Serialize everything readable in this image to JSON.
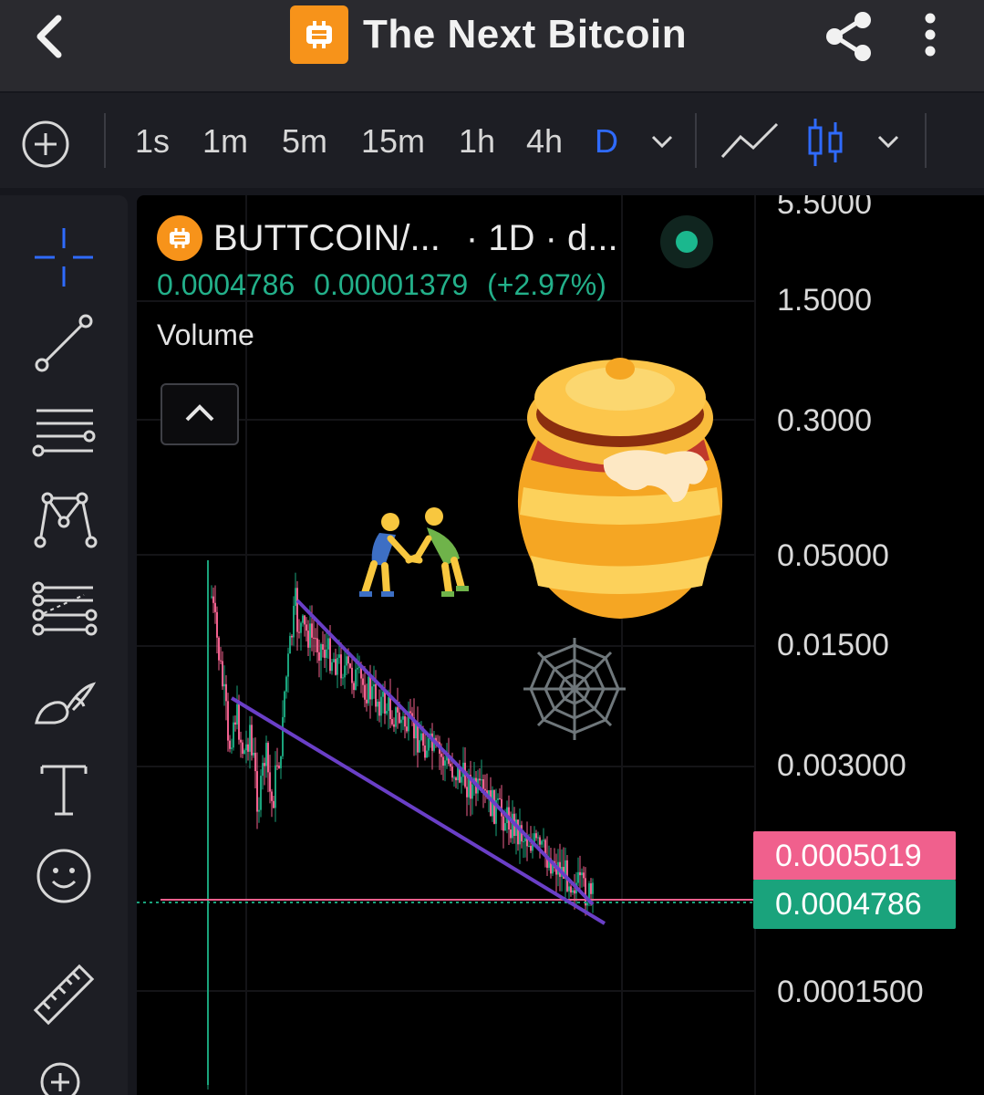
{
  "header": {
    "title": "The Next Bitcoin",
    "logo_glyph": "₿"
  },
  "toolbar": {
    "timeframes": [
      "1s",
      "1m",
      "5m",
      "15m",
      "1h",
      "4h",
      "D"
    ],
    "active_timeframe": "D"
  },
  "legend": {
    "symbol": "BUTTCOIN/...",
    "interval": "· 1D · d...",
    "last_price": "0.0004786",
    "change": "0.00001379",
    "change_pct": "(+2.97%)",
    "volume_label": "Volume"
  },
  "price_axis": [
    "5.5000",
    "1.5000",
    "0.3000",
    "0.05000",
    "0.01500",
    "0.003000",
    "0.0001500"
  ],
  "price_tags": {
    "red": "0.0005019",
    "green": "0.0004786"
  },
  "colors": {
    "up": "#1aa37c",
    "down": "#f0608d",
    "trendline": "#6a3fc7",
    "accent": "#2f6bff",
    "brand": "#f7931a"
  },
  "stickers": [
    "people-wrestling",
    "honey-pot",
    "spider-web"
  ]
}
